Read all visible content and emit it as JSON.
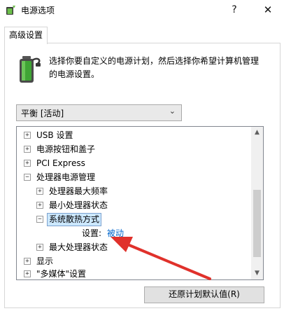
{
  "window": {
    "title": "电源选项",
    "help_label": "?",
    "close_label": "✕"
  },
  "tab": {
    "label": "高级设置"
  },
  "description": "选择你要自定义的电源计划，然后选择你希望计算机管理的电源设置。",
  "plan_select": {
    "value": "平衡 [活动]"
  },
  "tree": {
    "items": [
      {
        "label": "USB 设置",
        "expander": "+"
      },
      {
        "label": "电源按钮和盖子",
        "expander": "+"
      },
      {
        "label": "PCI Express",
        "expander": "+"
      },
      {
        "label": "处理器电源管理",
        "expander": "−"
      },
      {
        "label": "处理器最大频率",
        "expander": "+"
      },
      {
        "label": "最小处理器状态",
        "expander": "+"
      },
      {
        "label": "系统散热方式",
        "expander": "−"
      },
      {
        "label": "设置:",
        "value": "被动"
      },
      {
        "label": "最大处理器状态",
        "expander": "+"
      },
      {
        "label": "显示",
        "expander": "+"
      },
      {
        "label": "\"多媒体\"设置",
        "expander": "+"
      }
    ]
  },
  "restore_button": {
    "label": "还原计划默认值(R)"
  },
  "colors": {
    "annotation_arrow": "#e0312b",
    "link_value": "#0066cc",
    "selection": "#cce8ff"
  }
}
